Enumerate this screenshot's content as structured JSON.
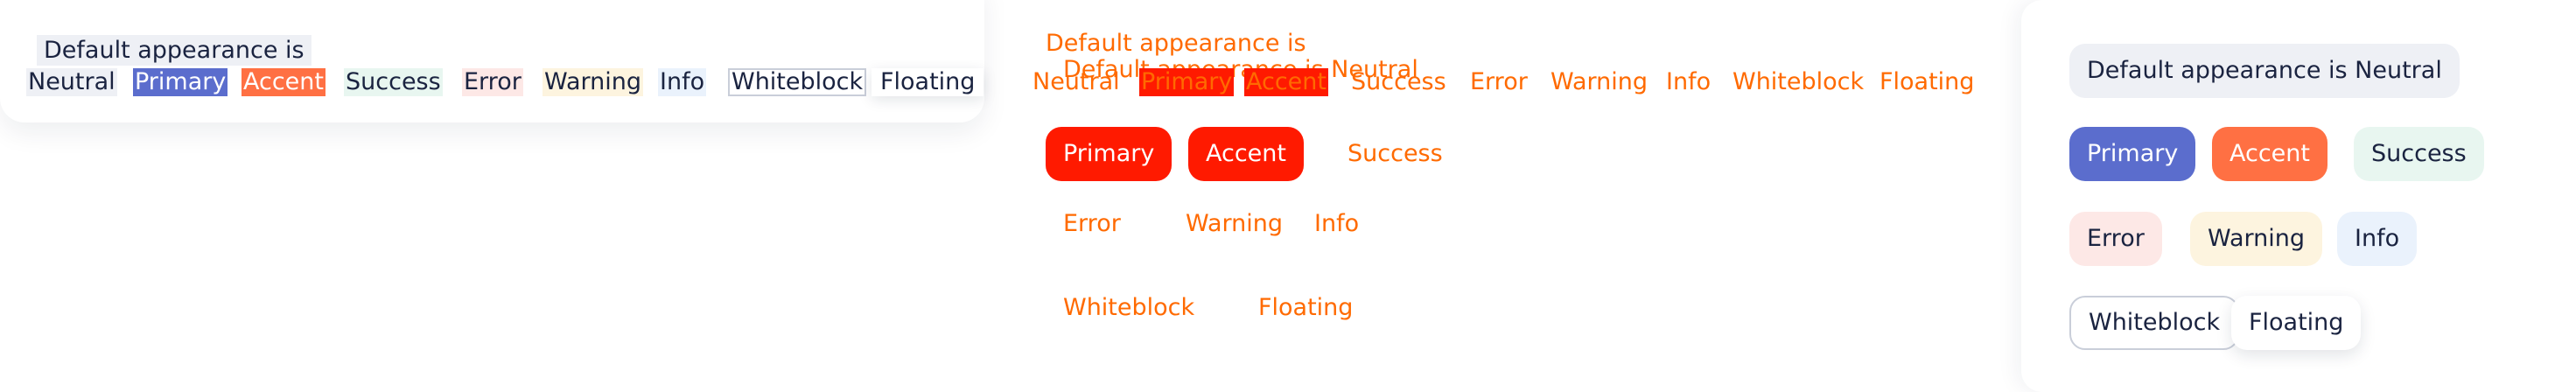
{
  "panel_raw": {
    "title": "Default appearance is",
    "badges": [
      "Neutral",
      "Primary",
      "Accent",
      "Success",
      "Error",
      "Warning",
      "Info",
      "Whiteblock",
      "Floating"
    ]
  },
  "panel_overlap": {
    "title_line1": "Default appearance is",
    "title_line2": "Default appearance is Neutral",
    "row_badges": [
      "Neutral",
      "Primary",
      "Accent",
      "Success",
      "Error",
      "Warning",
      "Info",
      "Whiteblock",
      "Floating"
    ],
    "buttons": [
      "Primary",
      "Accent",
      "Success",
      "Error",
      "Warning",
      "Info",
      "Whiteblock",
      "Floating"
    ],
    "text_color": "#ff6a00",
    "fill_color": "#ff1a00"
  },
  "panel_styled": {
    "title": "Default appearance is Neutral",
    "badges": [
      "Primary",
      "Accent",
      "Success",
      "Error",
      "Warning",
      "Info",
      "Whiteblock",
      "Floating"
    ],
    "colors": {
      "neutral": "#eef0f5",
      "primary": "#5b6dcd",
      "accent": "#ff7043",
      "success": "#e8f6f0",
      "error": "#fde8e6",
      "warning": "#fdf4df",
      "info": "#eaf2fc",
      "text": "#1a2340"
    }
  }
}
